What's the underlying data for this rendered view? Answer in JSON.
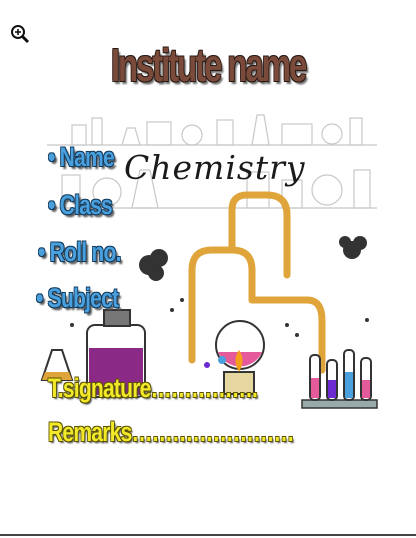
{
  "toolbar": {
    "zoom_icon": "zoom-in-icon"
  },
  "title": "Institute name",
  "illustration": {
    "word": "Chemistry"
  },
  "fields": [
    {
      "label": "Name"
    },
    {
      "label": "Class"
    },
    {
      "label": "Roll no."
    },
    {
      "label": "Subject"
    }
  ],
  "signature": "T.signature…………….",
  "remarks": "Remarks……………………",
  "colors": {
    "title": "#7a4a3a",
    "field_blue": "#4aa0dd",
    "field_yellow": "#f1e92a"
  }
}
